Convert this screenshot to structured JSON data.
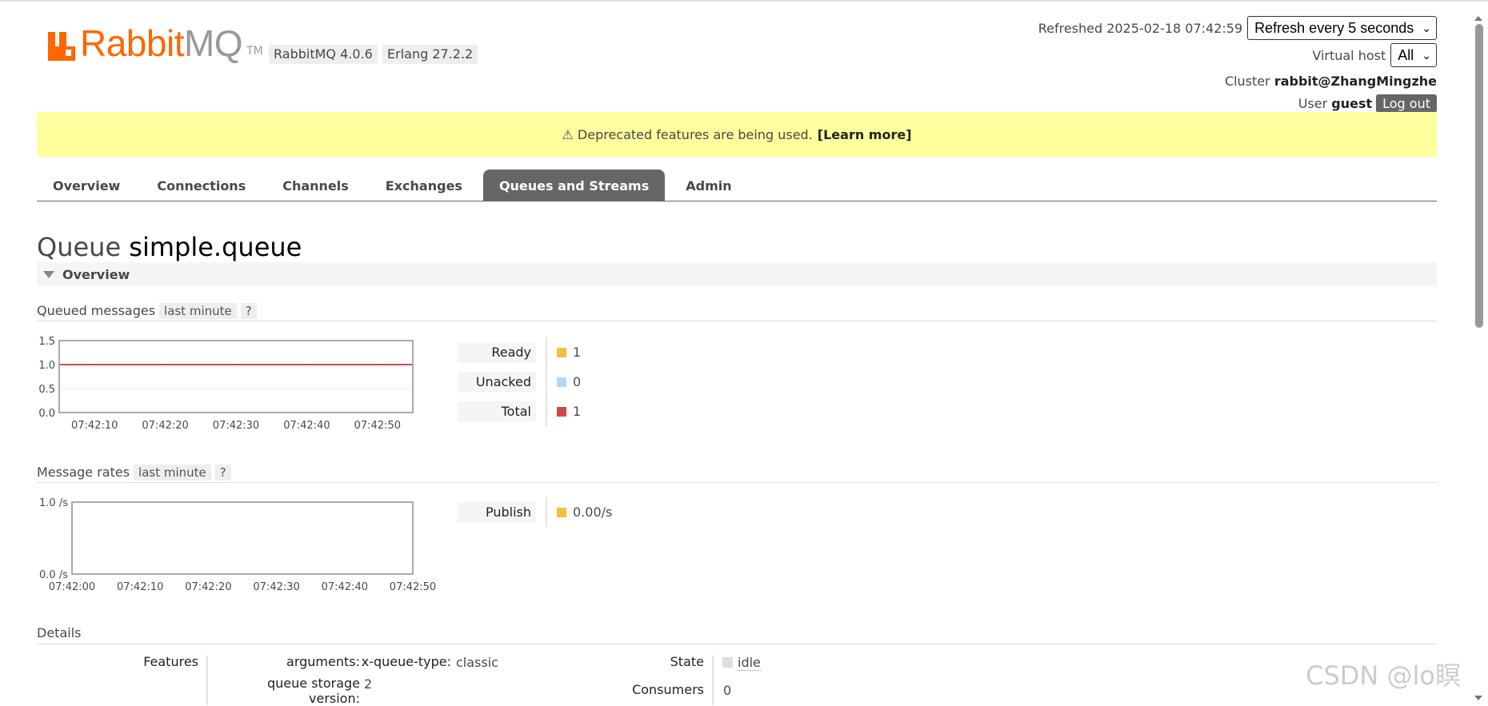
{
  "brand": {
    "rabbit": "Rabbit",
    "mq": "MQ",
    "tm": "TM"
  },
  "versions": {
    "rabbitmq": "RabbitMQ 4.0.6",
    "erlang": "Erlang 27.2.2"
  },
  "header": {
    "refreshed_label": "Refreshed 2025-02-18 07:42:59",
    "refresh_select": "Refresh every 5 seconds",
    "vhost_label": "Virtual host",
    "vhost_select": "All",
    "cluster_label": "Cluster",
    "cluster_name": "rabbit@ZhangMingzhe",
    "user_label": "User",
    "user_name": "guest",
    "logout": "Log out"
  },
  "deprecation": {
    "text": "⚠ Deprecated features are being used.",
    "link": "[Learn more]"
  },
  "tabs": [
    {
      "label": "Overview",
      "active": false
    },
    {
      "label": "Connections",
      "active": false
    },
    {
      "label": "Channels",
      "active": false
    },
    {
      "label": "Exchanges",
      "active": false
    },
    {
      "label": "Queues and Streams",
      "active": true
    },
    {
      "label": "Admin",
      "active": false
    }
  ],
  "page": {
    "title_prefix": "Queue",
    "queue_name": "simple.queue",
    "section": "Overview"
  },
  "queued_messages": {
    "heading": "Queued messages",
    "period": "last minute",
    "help": "?",
    "legend": [
      {
        "label": "Ready",
        "value": "1",
        "color": "#edc240"
      },
      {
        "label": "Unacked",
        "value": "0",
        "color": "#afd8f8"
      },
      {
        "label": "Total",
        "value": "1",
        "color": "#cb4b4b"
      }
    ]
  },
  "message_rates": {
    "heading": "Message rates",
    "period": "last minute",
    "help": "?",
    "legend": [
      {
        "label": "Publish",
        "value": "0.00/s",
        "color": "#edc240"
      }
    ]
  },
  "chart_data": [
    {
      "type": "line",
      "x": [
        "07:42:05",
        "07:42:10",
        "07:42:20",
        "07:42:30",
        "07:42:40",
        "07:42:50",
        "07:42:55"
      ],
      "x_ticks": [
        "07:42:10",
        "07:42:20",
        "07:42:30",
        "07:42:40",
        "07:42:50"
      ],
      "y_ticks": [
        "1.5",
        "1.0",
        "0.5",
        "0.0"
      ],
      "ylim": [
        0,
        1.5
      ],
      "series": [
        {
          "name": "Ready",
          "color": "#edc240",
          "values": [
            1,
            1,
            1,
            1,
            1,
            1,
            1
          ]
        },
        {
          "name": "Unacked",
          "color": "#afd8f8",
          "values": [
            0,
            0,
            0,
            0,
            0,
            0,
            0
          ]
        },
        {
          "name": "Total",
          "color": "#cb4b4b",
          "values": [
            1,
            1,
            1,
            1,
            1,
            1,
            1
          ]
        }
      ],
      "grid": true
    },
    {
      "type": "line",
      "x": [
        "07:42:00",
        "07:42:10",
        "07:42:20",
        "07:42:30",
        "07:42:40",
        "07:42:50"
      ],
      "x_ticks": [
        "07:42:00",
        "07:42:10",
        "07:42:20",
        "07:42:30",
        "07:42:40",
        "07:42:50"
      ],
      "y_ticks": [
        "1.0 /s",
        "0.0 /s"
      ],
      "ylim": [
        0,
        1
      ],
      "series": [
        {
          "name": "Publish",
          "color": "#edc240",
          "values": [
            0,
            0,
            0,
            0,
            0,
            0
          ]
        }
      ],
      "grid": true
    }
  ],
  "details": {
    "heading": "Details",
    "features_label": "Features",
    "arguments_label": "arguments:",
    "arg_key": "x-queue-type:",
    "arg_value": "classic",
    "storage_label": "queue storage version:",
    "storage_value": "2",
    "state_label": "State",
    "state_value": "idle",
    "consumers_label": "Consumers",
    "consumers_value": "0"
  },
  "watermark": "CSDN @lo瞑"
}
